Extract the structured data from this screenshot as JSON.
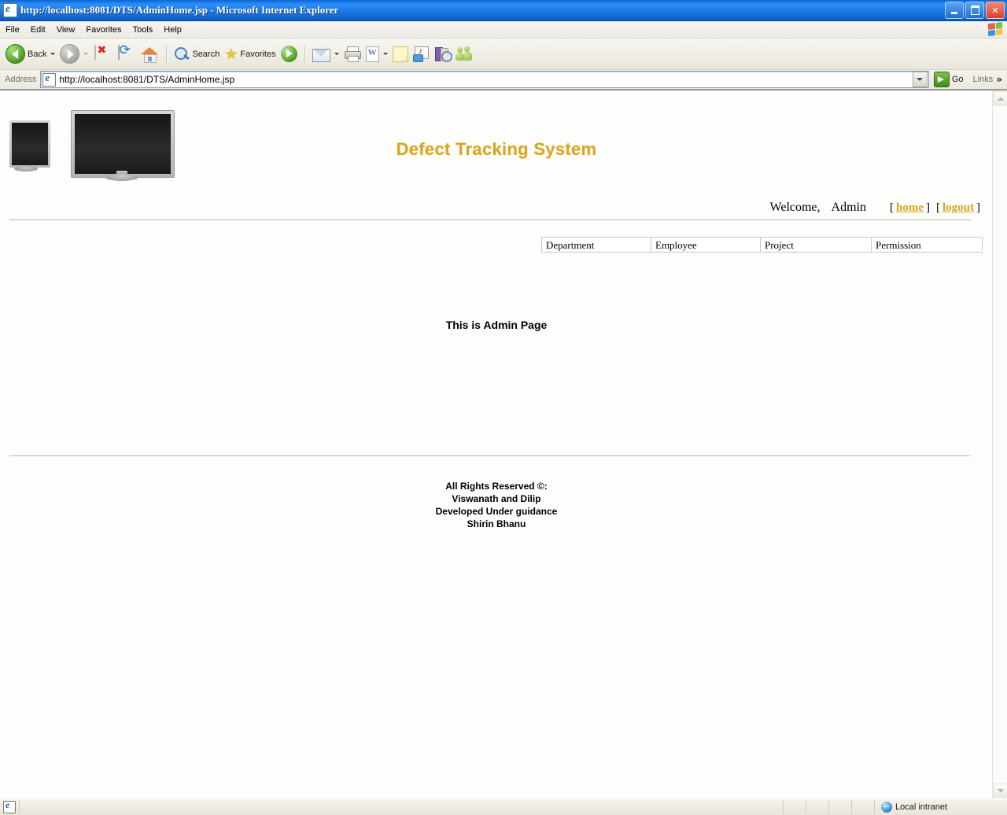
{
  "window": {
    "title_url": "http://localhost:8081/DTS/AdminHome.jsp",
    "title_suffix": " - Microsoft Internet Explorer",
    "icon": "ie-document-icon",
    "minimize_label": "Minimize",
    "restore_label": "Restore",
    "close_label": "Close"
  },
  "menubar": {
    "items": [
      {
        "label": "File"
      },
      {
        "label": "Edit"
      },
      {
        "label": "View"
      },
      {
        "label": "Favorites"
      },
      {
        "label": "Tools"
      },
      {
        "label": "Help"
      }
    ],
    "brand_icon": "windows-flag-icon"
  },
  "toolbar": {
    "back_label": "Back",
    "search_label": "Search",
    "favorites_label": "Favorites",
    "icons": [
      "back-icon",
      "forward-icon",
      "stop-icon",
      "refresh-icon",
      "home-icon",
      "search-icon",
      "favorites-star-icon",
      "media-icon",
      "mail-icon",
      "print-icon",
      "edit-word-icon",
      "note-icon",
      "messenger-icon",
      "research-icon",
      "people-icon"
    ]
  },
  "addressbar": {
    "label": "Address",
    "url": "http://localhost:8081/DTS/AdminHome.jsp",
    "placeholder": "Address",
    "go_label": "Go",
    "links_label": "Links",
    "overflow_glyph": "»"
  },
  "page": {
    "logo_alt": "row-of-lcd-monitors",
    "site_title": "Defect Tracking System",
    "title_color": "#daa520",
    "welcome": {
      "greeting": "Welcome,",
      "user": "Admin",
      "open_bracket": "[",
      "close_bracket": "]",
      "home_link": "home",
      "logout_link": "logout"
    },
    "nav": [
      {
        "label": "Department"
      },
      {
        "label": "Employee"
      },
      {
        "label": "Project"
      },
      {
        "label": "Permission"
      }
    ],
    "main_message": "This is Admin Page",
    "footer_lines": [
      "All Rights Reserved ©:",
      "Viswanath and Dilip",
      "Developed Under guidance",
      "Shirin Bhanu"
    ]
  },
  "statusbar": {
    "zone": "Local intranet",
    "zone_icon": "globe-icon",
    "page_icon": "ie-document-icon"
  }
}
